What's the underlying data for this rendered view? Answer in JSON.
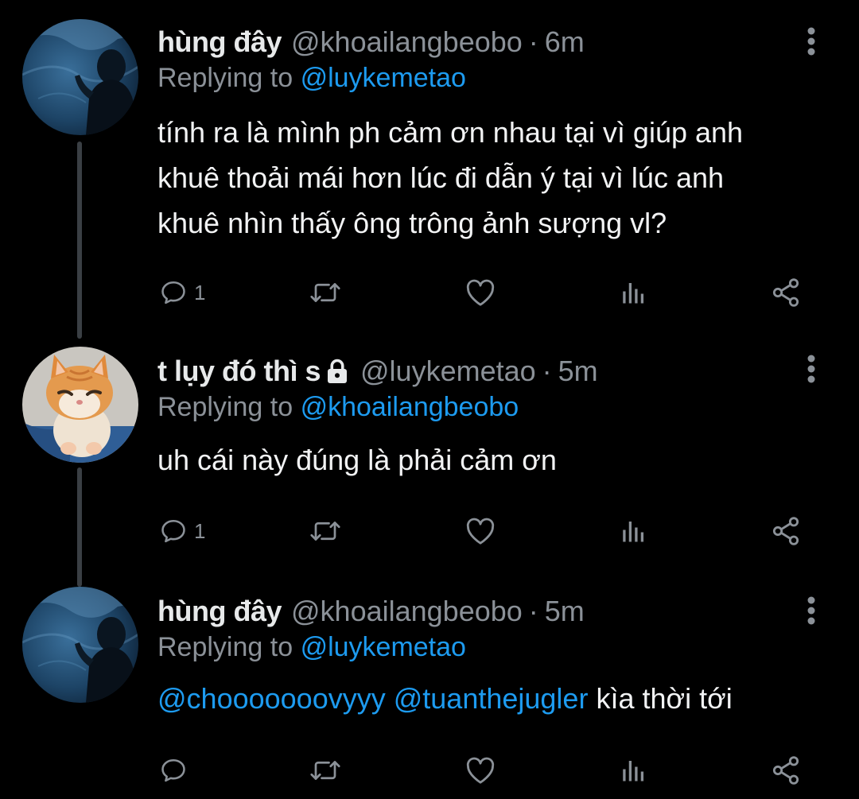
{
  "colors": {
    "background": "#000000",
    "text": "#e7e9ea",
    "secondary_text": "#8b9198",
    "mention": "#1d9bf0",
    "thread_line": "#3a3f44"
  },
  "tweets": [
    {
      "display_name": "hùng đây",
      "handle": "@khoailangbeobo",
      "separator": "·",
      "time": "6m",
      "replying_prefix": "Replying to",
      "replying_to": "@luykemetao",
      "text_lines": [
        "tính ra là mình ph cảm ơn nhau tại vì giúp anh",
        "khuê thoải mái hơn lúc đi dẫn ý tại vì lúc anh",
        "khuê nhìn thấy ông trông ảnh sượng vl?"
      ],
      "reply_count": "1",
      "avatar": "ocean-figure-avatar",
      "protected": false
    },
    {
      "display_name": "t lụy đó thì s",
      "handle": "@luykemetao",
      "separator": "·",
      "time": "5m",
      "replying_prefix": "Replying to",
      "replying_to": "@khoailangbeobo",
      "text_lines": [
        "uh cái này đúng là phải cảm ơn"
      ],
      "reply_count": "1",
      "avatar": "orange-cat-avatar",
      "protected": true,
      "protected_icon": "lock-icon"
    },
    {
      "display_name": "hùng đây",
      "handle": "@khoailangbeobo",
      "separator": "·",
      "time": "5m",
      "replying_prefix": "Replying to",
      "replying_to": "@luykemetao",
      "mention_1": "@chooooooovyyy",
      "mention_2": "@tuanthejugler",
      "text_tail": "kìa thời tới",
      "reply_count": "",
      "avatar": "ocean-figure-avatar",
      "protected": false
    }
  ],
  "icons": {
    "reply": "reply-icon",
    "retweet": "retweet-icon",
    "like": "heart-icon",
    "views": "analytics-icon",
    "share": "share-icon",
    "more": "more-vertical-icon"
  }
}
